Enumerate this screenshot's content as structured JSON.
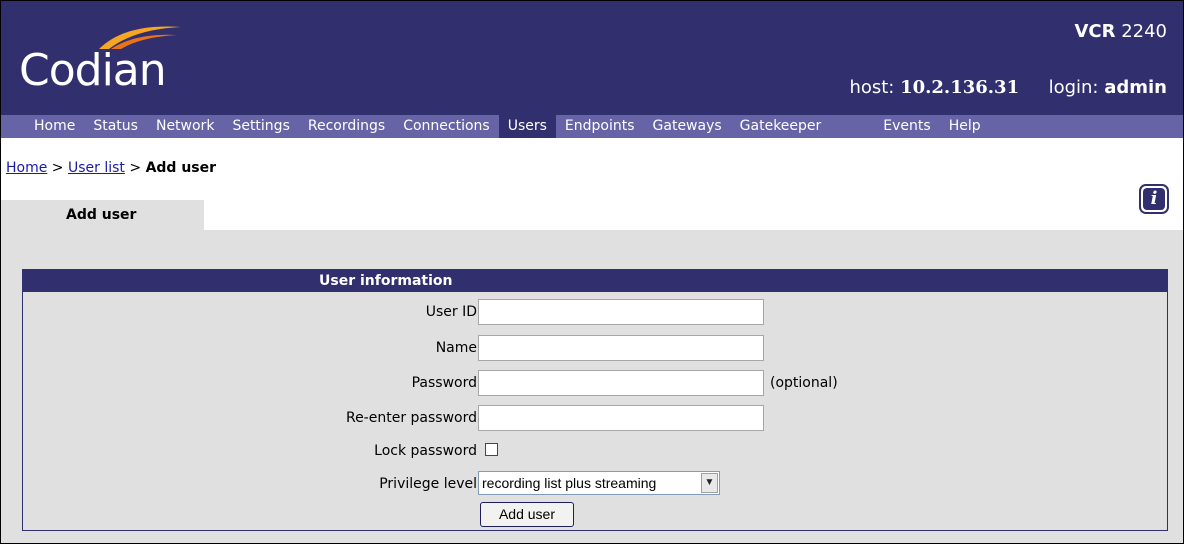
{
  "header": {
    "logo_text": "Codian",
    "product_bold": "VCR",
    "product_model": "2240",
    "host_label": "host:",
    "host_value": "10.2.136.31",
    "login_label": "login:",
    "login_value": "admin"
  },
  "nav": {
    "items": [
      "Home",
      "Status",
      "Network",
      "Settings",
      "Recordings",
      "Connections",
      "Users",
      "Endpoints",
      "Gateways",
      "Gatekeeper",
      "Events",
      "Help"
    ],
    "active": "Users"
  },
  "breadcrumb": {
    "home": "Home",
    "sep1": ">",
    "user_list": "User list",
    "sep2": ">",
    "current": "Add user"
  },
  "tab": {
    "label": "Add user"
  },
  "panel": {
    "title": "User information",
    "fields": {
      "user_id": {
        "label": "User ID",
        "value": ""
      },
      "name": {
        "label": "Name",
        "value": ""
      },
      "password": {
        "label": "Password",
        "value": "",
        "note": "(optional)"
      },
      "reenter": {
        "label": "Re-enter password",
        "value": ""
      },
      "lock": {
        "label": "Lock password",
        "checked": false
      },
      "privilege": {
        "label": "Privilege level",
        "selected": "recording list plus streaming"
      }
    },
    "submit_label": "Add user"
  },
  "colors": {
    "header_bg": "#312f6d",
    "nav_bg": "#6663a7",
    "content_bg": "#e0e0e0",
    "logo_swoosh": "#f5a623"
  },
  "icons": {
    "info": "info-icon",
    "dropdown": "chevron-down-icon"
  }
}
